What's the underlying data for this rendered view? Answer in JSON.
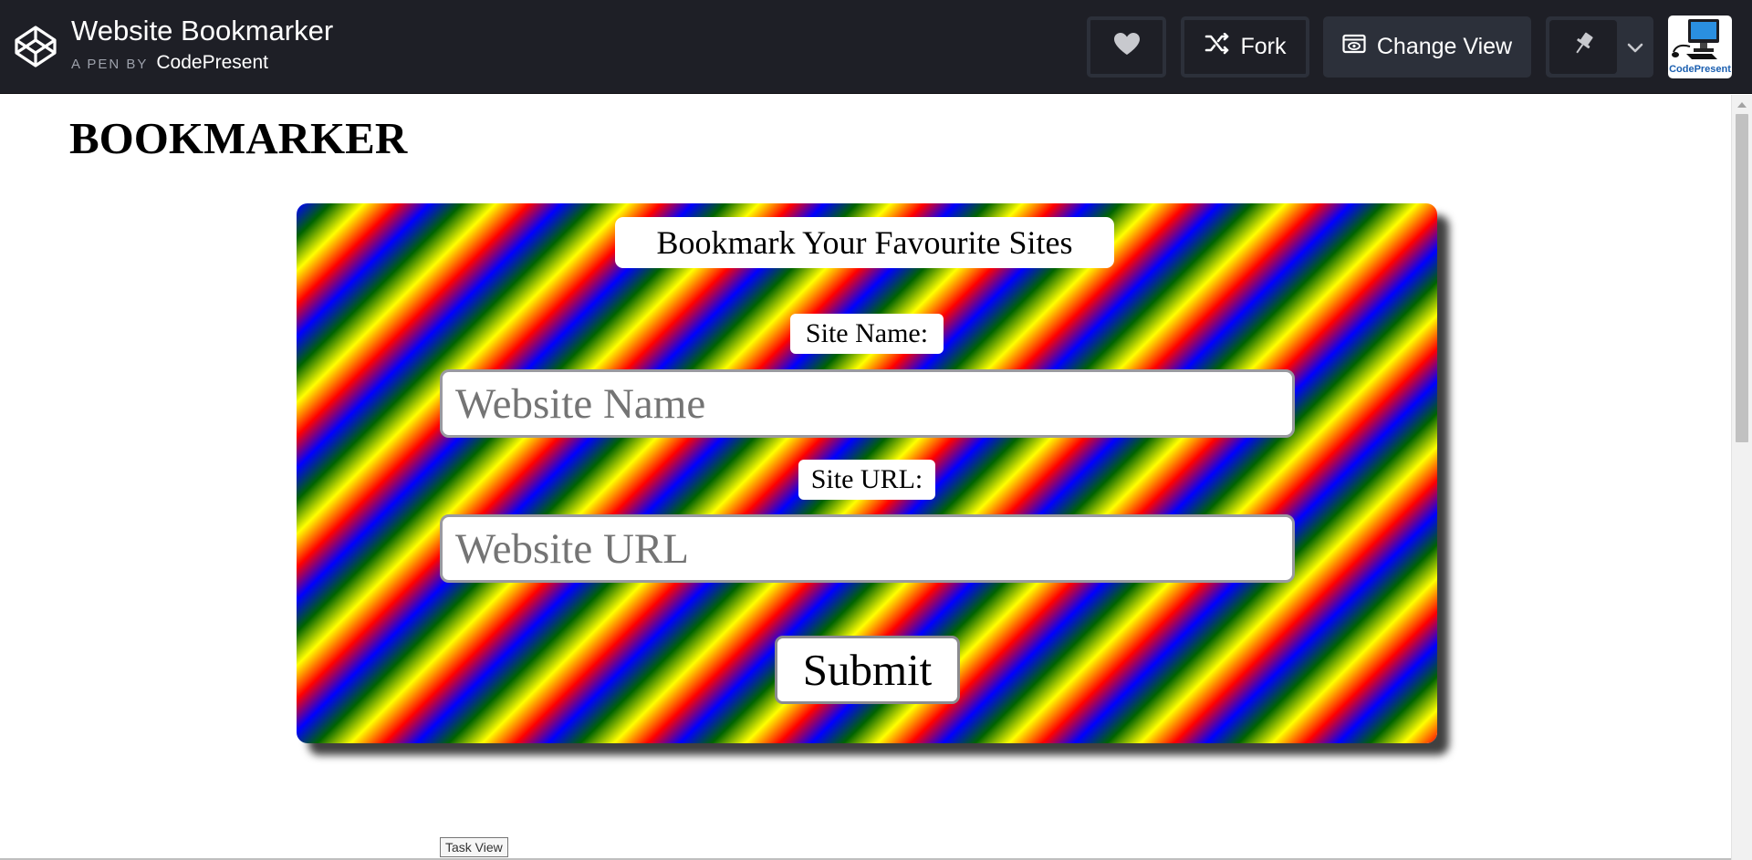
{
  "header": {
    "pen_title": "Website Bookmarker",
    "by_label": "A PEN BY",
    "author": "CodePresent",
    "fork_label": "Fork",
    "change_view_label": "Change View",
    "avatar_text": "CodePresent"
  },
  "page": {
    "heading": "BOOKMARKER"
  },
  "form": {
    "title": "Bookmark Your Favourite Sites",
    "site_name_label": "Site Name:",
    "site_name_placeholder": "Website Name",
    "site_url_label": "Site URL:",
    "site_url_placeholder": "Website URL",
    "submit_label": "Submit"
  },
  "tooltip": {
    "text": "Task View"
  },
  "colors": {
    "topbar": "#1e1f26",
    "button": "#2c303a",
    "stripes": [
      "#ff0000",
      "#ffff00",
      "#006400",
      "#0000ff"
    ]
  },
  "icons": {
    "logo": "codepen-logo-icon",
    "heart": "heart-icon",
    "fork": "fork-icon",
    "change_view": "eye-window-icon",
    "pin": "pin-icon",
    "caret": "chevron-down-icon"
  }
}
